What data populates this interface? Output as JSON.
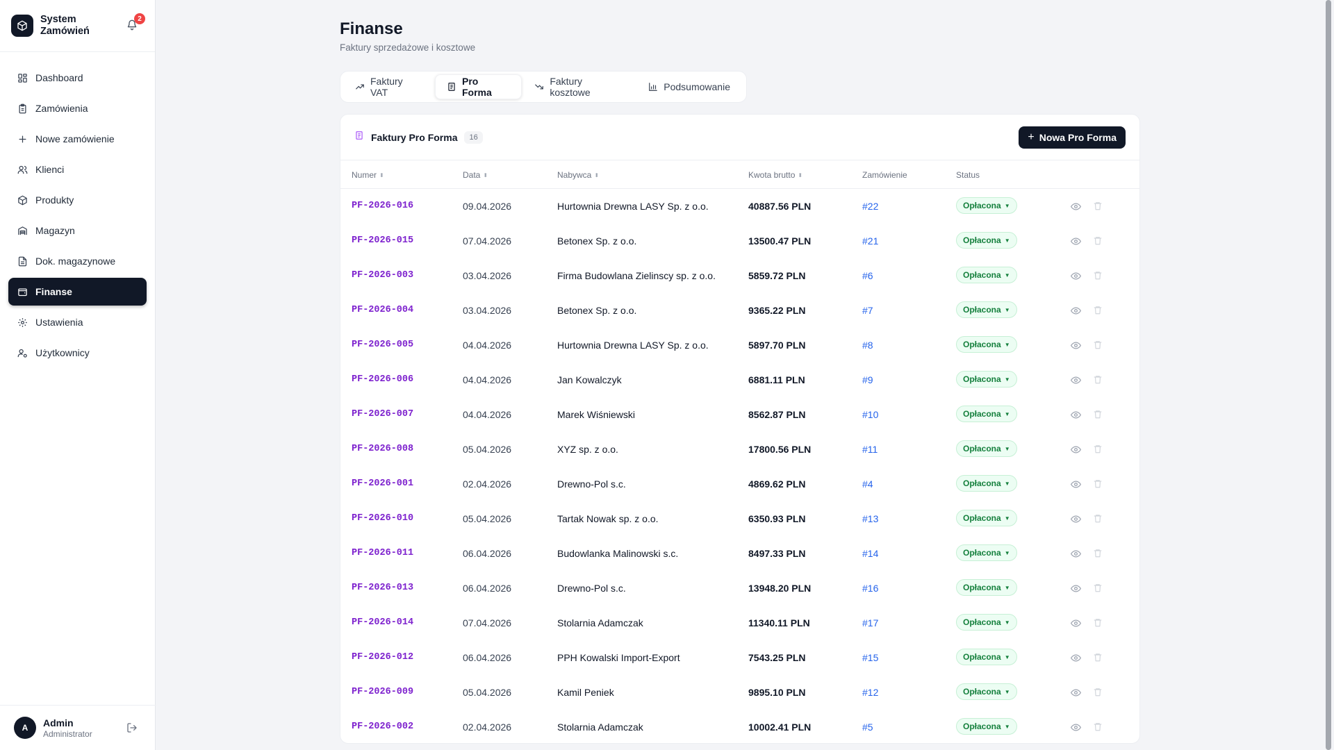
{
  "app": {
    "name": "System Zamówień",
    "notifications_count": "2"
  },
  "sidebar": {
    "items": [
      {
        "label": "Dashboard",
        "icon": "dashboard-icon",
        "active": false
      },
      {
        "label": "Zamówienia",
        "icon": "clipboard-icon",
        "active": false
      },
      {
        "label": "Nowe zamówienie",
        "icon": "plus-icon",
        "active": false
      },
      {
        "label": "Klienci",
        "icon": "users-icon",
        "active": false
      },
      {
        "label": "Produkty",
        "icon": "box-icon",
        "active": false
      },
      {
        "label": "Magazyn",
        "icon": "warehouse-icon",
        "active": false
      },
      {
        "label": "Dok. magazynowe",
        "icon": "document-icon",
        "active": false
      },
      {
        "label": "Finanse",
        "icon": "wallet-icon",
        "active": true
      },
      {
        "label": "Ustawienia",
        "icon": "gear-icon",
        "active": false
      },
      {
        "label": "Użytkownicy",
        "icon": "user-cog-icon",
        "active": false
      }
    ]
  },
  "user": {
    "initial": "A",
    "name": "Admin",
    "role": "Administrator"
  },
  "header": {
    "title": "Finanse",
    "subtitle": "Faktury sprzedażowe i kosztowe"
  },
  "tabs": [
    {
      "label": "Faktury VAT",
      "icon": "trend-up-icon",
      "active": false
    },
    {
      "label": "Pro Forma",
      "icon": "receipt-icon",
      "active": true
    },
    {
      "label": "Faktury kosztowe",
      "icon": "trend-down-icon",
      "active": false
    },
    {
      "label": "Podsumowanie",
      "icon": "bar-chart-icon",
      "active": false
    }
  ],
  "card": {
    "title": "Faktury Pro Forma",
    "count": "16",
    "new_button": "Nowa Pro Forma"
  },
  "table": {
    "columns": {
      "number": "Numer",
      "date": "Data",
      "buyer": "Nabywca",
      "amount": "Kwota brutto",
      "order": "Zamówienie",
      "status": "Status"
    },
    "rows": [
      {
        "number": "PF-2026-016",
        "date": "09.04.2026",
        "buyer": "Hurtownia Drewna LASY Sp. z o.o.",
        "amount": "40887.56 PLN",
        "order": "#22",
        "status": "Opłacona"
      },
      {
        "number": "PF-2026-015",
        "date": "07.04.2026",
        "buyer": "Betonex Sp. z o.o.",
        "amount": "13500.47 PLN",
        "order": "#21",
        "status": "Opłacona"
      },
      {
        "number": "PF-2026-003",
        "date": "03.04.2026",
        "buyer": "Firma Budowlana Zielinscy sp. z o.o.",
        "amount": "5859.72 PLN",
        "order": "#6",
        "status": "Opłacona"
      },
      {
        "number": "PF-2026-004",
        "date": "03.04.2026",
        "buyer": "Betonex Sp. z o.o.",
        "amount": "9365.22 PLN",
        "order": "#7",
        "status": "Opłacona"
      },
      {
        "number": "PF-2026-005",
        "date": "04.04.2026",
        "buyer": "Hurtownia Drewna LASY Sp. z o.o.",
        "amount": "5897.70 PLN",
        "order": "#8",
        "status": "Opłacona"
      },
      {
        "number": "PF-2026-006",
        "date": "04.04.2026",
        "buyer": "Jan Kowalczyk",
        "amount": "6881.11 PLN",
        "order": "#9",
        "status": "Opłacona"
      },
      {
        "number": "PF-2026-007",
        "date": "04.04.2026",
        "buyer": "Marek Wiśniewski",
        "amount": "8562.87 PLN",
        "order": "#10",
        "status": "Opłacona"
      },
      {
        "number": "PF-2026-008",
        "date": "05.04.2026",
        "buyer": "XYZ sp. z o.o.",
        "amount": "17800.56 PLN",
        "order": "#11",
        "status": "Opłacona"
      },
      {
        "number": "PF-2026-001",
        "date": "02.04.2026",
        "buyer": "Drewno-Pol s.c.",
        "amount": "4869.62 PLN",
        "order": "#4",
        "status": "Opłacona"
      },
      {
        "number": "PF-2026-010",
        "date": "05.04.2026",
        "buyer": "Tartak Nowak sp. z o.o.",
        "amount": "6350.93 PLN",
        "order": "#13",
        "status": "Opłacona"
      },
      {
        "number": "PF-2026-011",
        "date": "06.04.2026",
        "buyer": "Budowlanka Malinowski s.c.",
        "amount": "8497.33 PLN",
        "order": "#14",
        "status": "Opłacona"
      },
      {
        "number": "PF-2026-013",
        "date": "06.04.2026",
        "buyer": "Drewno-Pol s.c.",
        "amount": "13948.20 PLN",
        "order": "#16",
        "status": "Opłacona"
      },
      {
        "number": "PF-2026-014",
        "date": "07.04.2026",
        "buyer": "Stolarnia Adamczak",
        "amount": "11340.11 PLN",
        "order": "#17",
        "status": "Opłacona"
      },
      {
        "number": "PF-2026-012",
        "date": "06.04.2026",
        "buyer": "PPH Kowalski Import-Export",
        "amount": "7543.25 PLN",
        "order": "#15",
        "status": "Opłacona"
      },
      {
        "number": "PF-2026-009",
        "date": "05.04.2026",
        "buyer": "Kamil Peniek",
        "amount": "9895.10 PLN",
        "order": "#12",
        "status": "Opłacona"
      },
      {
        "number": "PF-2026-002",
        "date": "02.04.2026",
        "buyer": "Stolarnia Adamczak",
        "amount": "10002.41 PLN",
        "order": "#5",
        "status": "Opłacona"
      }
    ]
  },
  "colors": {
    "accent": "#111827",
    "invoice_number": "#7e22ce",
    "order_link": "#2563eb",
    "status_paid": "#15803d",
    "badge": "#ef4444"
  }
}
